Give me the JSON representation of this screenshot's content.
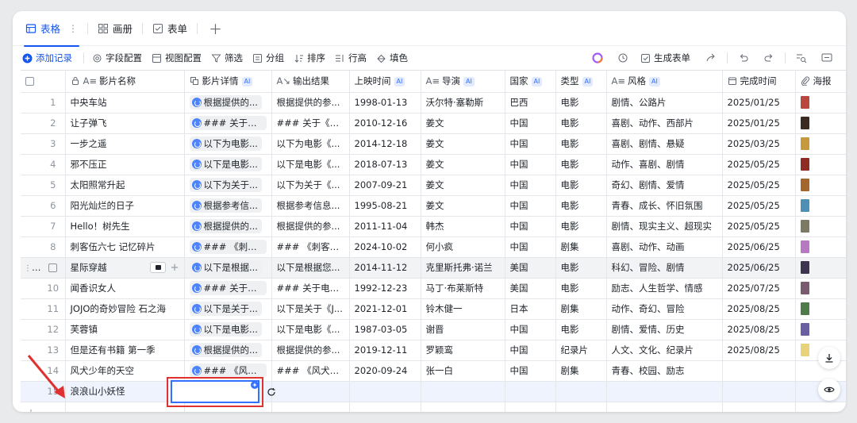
{
  "tabs": [
    {
      "label": "表格",
      "icon": "grid-icon",
      "active": true
    },
    {
      "label": "画册",
      "icon": "gallery-icon"
    },
    {
      "label": "表单",
      "icon": "form-icon"
    }
  ],
  "toolbar": {
    "add_record": "添加记录",
    "field_config": "字段配置",
    "view_config": "视图配置",
    "filter": "筛选",
    "group": "分组",
    "sort": "排序",
    "row_height": "行高",
    "fill": "填色",
    "generate_form": "生成表单"
  },
  "columns": [
    {
      "label": "影片名称",
      "icon": "lock-text-icon",
      "ai": false
    },
    {
      "label": "影片详情",
      "icon": "copy-icon",
      "ai": true
    },
    {
      "label": "输出结果",
      "icon": "text-arrow-icon",
      "ai": false
    },
    {
      "label": "上映时间",
      "icon": "",
      "ai": true
    },
    {
      "label": "导演",
      "icon": "text-icon",
      "ai": true
    },
    {
      "label": "国家",
      "icon": "",
      "ai": true
    },
    {
      "label": "类型",
      "icon": "",
      "ai": true
    },
    {
      "label": "风格",
      "icon": "text-icon",
      "ai": true
    },
    {
      "label": "完成时间",
      "icon": "calendar-icon",
      "ai": false
    },
    {
      "label": "海报",
      "icon": "attachment-icon",
      "ai": false
    }
  ],
  "ai_badge": "AI",
  "rows": [
    {
      "n": "1",
      "name": "中央车站",
      "detail": "根据提供的...",
      "output": "根据提供的参...",
      "date": "1998-01-13",
      "director": "沃尔特·塞勒斯",
      "country": "巴西",
      "type": "电影",
      "style": "剧情、公路片",
      "done": "2025/01/25",
      "poster": "#b9473e"
    },
    {
      "n": "2",
      "name": "让子弹飞",
      "detail": "### 关于《...",
      "output": "### 关于《让...",
      "date": "2010-12-16",
      "director": "姜文",
      "country": "中国",
      "type": "电影",
      "style": "喜剧、动作、西部片",
      "done": "2025/01/25",
      "poster": "#3a2a22"
    },
    {
      "n": "3",
      "name": "一步之遥",
      "detail": "以下为电影...",
      "output": "以下为电影《...",
      "date": "2014-12-18",
      "director": "姜文",
      "country": "中国",
      "type": "电影",
      "style": "喜剧、剧情、悬疑",
      "done": "2025/03/25",
      "poster": "#c69a3c"
    },
    {
      "n": "4",
      "name": "邪不压正",
      "detail": "以下是电影...",
      "output": "以下是电影《...",
      "date": "2018-07-13",
      "director": "姜文",
      "country": "中国",
      "type": "电影",
      "style": "动作、喜剧、剧情",
      "done": "2025/05/25",
      "poster": "#8e2b22"
    },
    {
      "n": "5",
      "name": "太阳照常升起",
      "detail": "以下为关于...",
      "output": "以下为关于《...",
      "date": "2007-09-21",
      "director": "姜文",
      "country": "中国",
      "type": "电影",
      "style": "奇幻、剧情、爱情",
      "done": "2025/05/25",
      "poster": "#a3672d"
    },
    {
      "n": "6",
      "name": "阳光灿烂的日子",
      "detail": "根据参考信...",
      "output": "根据参考信息...",
      "date": "1995-08-21",
      "director": "姜文",
      "country": "中国",
      "type": "电影",
      "style": "青春、成长、怀旧氛围",
      "done": "2025/05/25",
      "poster": "#4e8fb5"
    },
    {
      "n": "7",
      "name": "Hello！树先生",
      "detail": "根据提供的...",
      "output": "根据提供的参...",
      "date": "2011-11-04",
      "director": "韩杰",
      "country": "中国",
      "type": "电影",
      "style": "剧情、现实主义、超现实",
      "done": "2025/05/25",
      "poster": "#7c7a63"
    },
    {
      "n": "8",
      "name": "刺客伍六七 记忆碎片",
      "detail": "### 《刺客...",
      "output": "### 《刺客伍...",
      "date": "2024-10-02",
      "director": "何小疯",
      "country": "中国",
      "type": "剧集",
      "style": "喜剧、动作、动画",
      "done": "2025/06/25",
      "poster": "#b77ac2"
    },
    {
      "n": "",
      "name": "星际穿越",
      "detail": "以下是根据...",
      "output": "以下是根据您...",
      "date": "2014-11-12",
      "director": "克里斯托弗·诺兰",
      "country": "美国",
      "type": "电影",
      "style": "科幻、冒险、剧情",
      "done": "2025/06/25",
      "poster": "#3d3550",
      "hl": true
    },
    {
      "n": "10",
      "name": "闻香识女人",
      "detail": "### 关于电...",
      "output": "### 关于电影...",
      "date": "1992-12-23",
      "director": "马丁·布莱斯特",
      "country": "美国",
      "type": "电影",
      "style": "励志、人生哲学、情感",
      "done": "2025/07/25",
      "poster": "#7a5a6e"
    },
    {
      "n": "11",
      "name": "JOJO的奇妙冒险 石之海",
      "detail": "以下是关于...",
      "output": "以下是关于《J...",
      "date": "2021-12-01",
      "director": "铃木健一",
      "country": "日本",
      "type": "剧集",
      "style": "动作、奇幻、冒险",
      "done": "2025/08/25",
      "poster": "#4f7a4a"
    },
    {
      "n": "12",
      "name": "芙蓉镇",
      "detail": "以下是电影...",
      "output": "以下是电影《...",
      "date": "1987-03-05",
      "director": "谢晋",
      "country": "中国",
      "type": "电影",
      "style": "剧情、爱情、历史",
      "done": "2025/08/25",
      "poster": "#6a5fa3"
    },
    {
      "n": "13",
      "name": "但是还有书籍 第一季",
      "detail": "根据提供的...",
      "output": "根据提供的参...",
      "date": "2019-12-11",
      "director": "罗颖鸾",
      "country": "中国",
      "type": "纪录片",
      "style": "人文、文化、纪录片",
      "done": "2025/08/25",
      "poster": "#e8d27a"
    },
    {
      "n": "14",
      "name": "风犬少年的天空",
      "detail": "### 《风犬...",
      "output": "### 《风犬少...",
      "date": "2020-09-24",
      "director": "张一白",
      "country": "中国",
      "type": "剧集",
      "style": "青春、校园、励志",
      "done": "",
      "poster": ""
    }
  ],
  "new_row": {
    "n": "15",
    "name": "浪浪山小妖怪"
  }
}
